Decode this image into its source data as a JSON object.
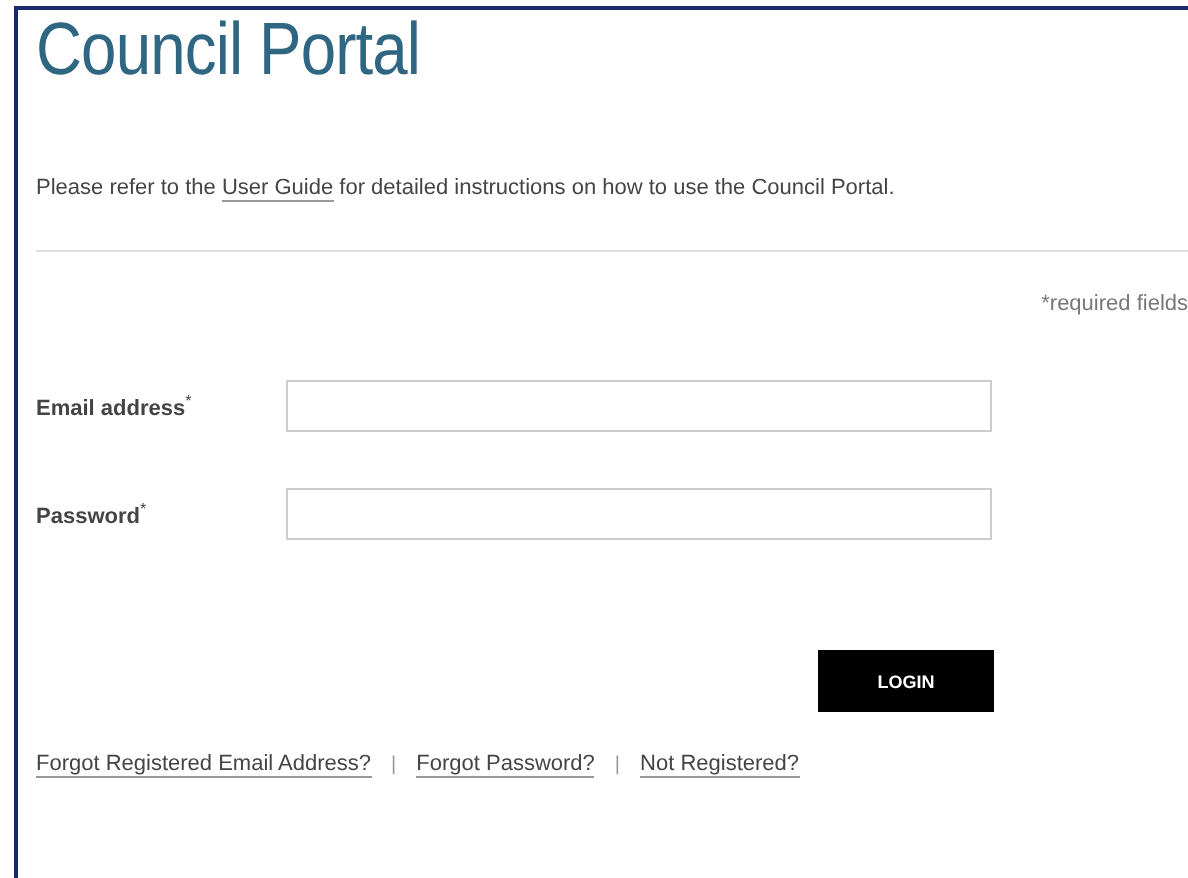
{
  "title": "Council Portal",
  "intro": {
    "before": "Please refer to the ",
    "link": "User Guide",
    "after": " for detailed instructions on how to use the Council Portal."
  },
  "required_note": "*required fields",
  "fields": [
    {
      "label": "Email address",
      "required_mark": "*"
    },
    {
      "label": "Password",
      "required_mark": "*"
    }
  ],
  "login_button": "LOGIN",
  "links": [
    {
      "label": "Forgot Registered Email Address?"
    },
    {
      "label": "Forgot Password?"
    },
    {
      "label": "Not Registered?"
    }
  ],
  "link_separator": "|"
}
